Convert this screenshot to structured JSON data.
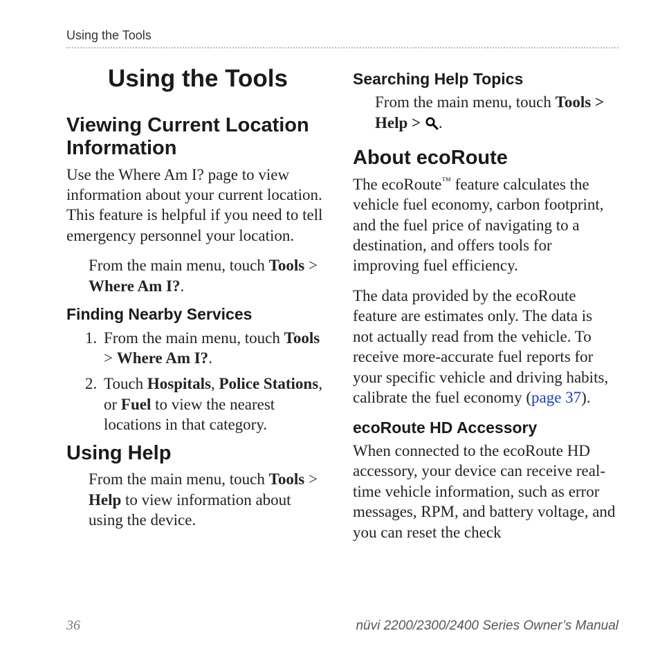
{
  "running_head": "Using the Tools",
  "title": "Using the Tools",
  "left": {
    "h2_viewing": "Viewing Current Location Information",
    "viewing_body": "Use the Where Am I? page to view information about your current location. This feature is helpful if you need to tell emergency personnel your location.",
    "viewing_step_prefix": "From the main menu, touch ",
    "viewing_step_b1": "Tools",
    "viewing_step_mid": " > ",
    "viewing_step_b2": "Where Am I?",
    "viewing_step_suffix": ".",
    "h3_nearby": "Finding Nearby Services",
    "nearby_li1_prefix": "From the main menu, touch ",
    "nearby_li1_b1": "Tools",
    "nearby_li1_mid": " > ",
    "nearby_li1_b2": "Where Am I?",
    "nearby_li1_suffix": ".",
    "nearby_li2_prefix": "Touch ",
    "nearby_li2_b1": "Hospitals",
    "nearby_li2_sep1": ", ",
    "nearby_li2_b2": "Police Stations",
    "nearby_li2_sep2": ", or ",
    "nearby_li2_b3": "Fuel",
    "nearby_li2_suffix": " to view the nearest locations in that category.",
    "h2_help": "Using Help",
    "help_step_prefix": "From the main menu, touch ",
    "help_step_b1": "Tools",
    "help_step_mid": " > ",
    "help_step_b2": "Help",
    "help_step_suffix": " to view information about using the device."
  },
  "right": {
    "h3_search": "Searching Help Topics",
    "search_step_prefix": "From the main menu, touch ",
    "search_step_b1": "Tools",
    "search_step_mid": " > ",
    "search_step_b2": "Help",
    "search_step_mid2": " > ",
    "search_step_suffix": ".",
    "h2_eco": "About ecoRoute",
    "eco_p1_a": "The ecoRoute",
    "eco_tm": "™",
    "eco_p1_b": " feature calculates the vehicle fuel economy, carbon footprint, and the fuel price of navigating to a destination, and offers tools for improving fuel efficiency.",
    "eco_p2_a": "The data provided by the ecoRoute feature are estimates only. The data is not actually read from the vehicle. To receive more-accurate fuel reports for your specific vehicle and driving habits, calibrate the fuel economy (",
    "eco_p2_link": "page 37",
    "eco_p2_b": ").",
    "h3_hd": "ecoRoute HD Accessory",
    "hd_body": "When connected to the ecoRoute HD accessory, your device can receive real-time vehicle information, such as error messages, RPM, and battery voltage, and you can reset the check"
  },
  "footer": {
    "page": "36",
    "manual": "nüvi 2200/2300/2400 Series Owner’s Manual"
  }
}
